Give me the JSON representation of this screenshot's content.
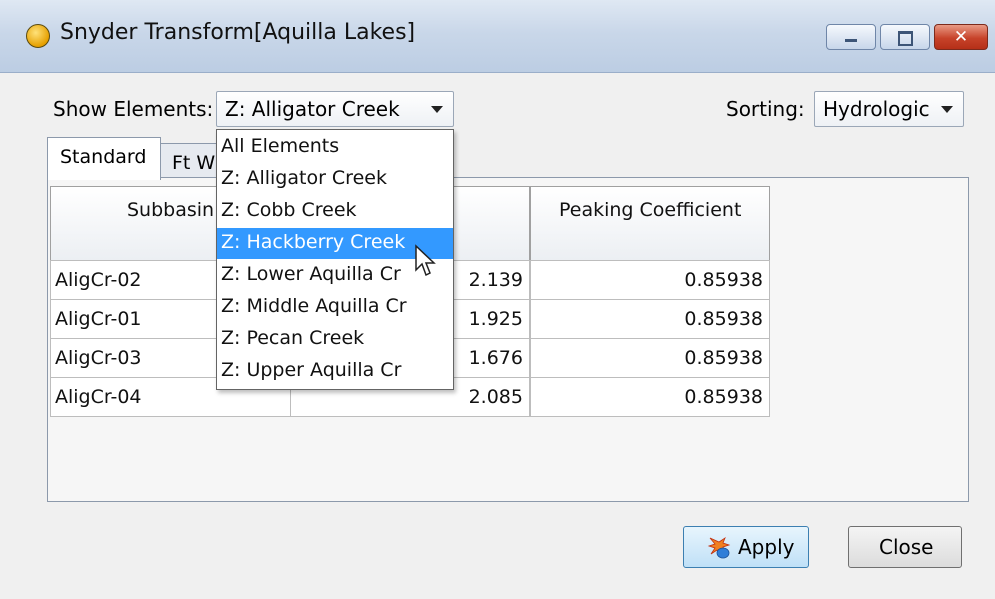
{
  "window": {
    "title": "Snyder Transform[Aquilla Lakes]"
  },
  "filters": {
    "show_elements_label": "Show Elements:",
    "show_elements_value": "Z: Alligator Creek",
    "sorting_label": "Sorting:",
    "sorting_value": "Hydrologic"
  },
  "dropdown": {
    "options": [
      "All Elements",
      "Z: Alligator Creek",
      "Z: Cobb Creek",
      "Z: Hackberry Creek",
      "Z: Lower Aquilla Cr",
      "Z: Middle Aquilla Cr",
      "Z: Pecan Creek",
      "Z: Upper Aquilla Cr"
    ],
    "highlighted": "Z: Hackberry Creek"
  },
  "tabs": [
    {
      "label": "Standard",
      "active": true
    },
    {
      "label": "Ft W",
      "active": false
    }
  ],
  "table": {
    "columns": [
      "Subbasin",
      "",
      "Peaking Coefficient"
    ],
    "rows": [
      {
        "subbasin": "AligCr-02",
        "lag": "2.139",
        "peaking": "0.85938"
      },
      {
        "subbasin": "AligCr-01",
        "lag": "1.925",
        "peaking": "0.85938"
      },
      {
        "subbasin": "AligCr-03",
        "lag": "1.676",
        "peaking": "0.85938"
      },
      {
        "subbasin": "AligCr-04",
        "lag": "2.085",
        "peaking": "0.85938"
      }
    ]
  },
  "buttons": {
    "apply": "Apply",
    "close": "Close"
  },
  "icons": {
    "title": "app-icon",
    "minimize": "minimize-icon",
    "maximize": "maximize-icon",
    "close": "close-icon",
    "apply": "apply-icon",
    "cursor": "mouse-cursor-icon"
  },
  "colors": {
    "selection": "#3399ff",
    "close_button": "#c7432a"
  }
}
